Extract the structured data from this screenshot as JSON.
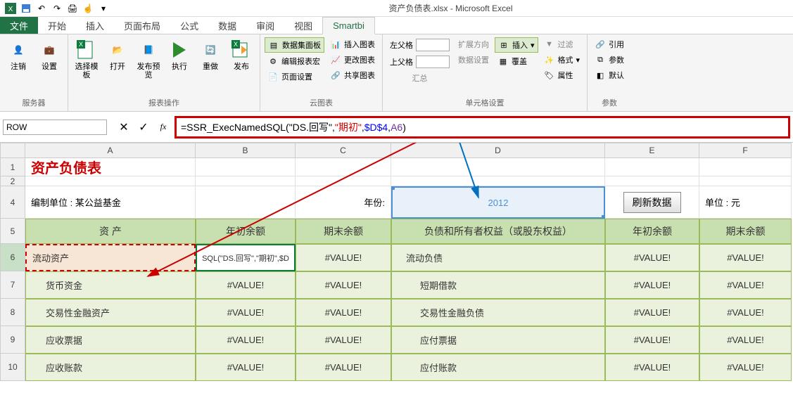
{
  "app": {
    "title": "资产负债表.xlsx - Microsoft Excel"
  },
  "tabs": {
    "file": "文件",
    "home": "开始",
    "insert": "插入",
    "layout": "页面布局",
    "formula": "公式",
    "data": "数据",
    "review": "审阅",
    "view": "视图",
    "smartbi": "Smartbi"
  },
  "ribbon": {
    "g_server": "服务器",
    "logout": "注销",
    "settings": "设置",
    "g_report": "报表操作",
    "choose_tpl": "选择模板",
    "open": "打开",
    "pub_preview": "发布预览",
    "exec": "执行",
    "redo": "重做",
    "publish": "发布",
    "g_chart": "云图表",
    "data_panel": "数据集面板",
    "edit_macro": "编辑报表宏",
    "page_setup": "页面设置",
    "insert_chart": "插入图表",
    "change_chart": "更改图表",
    "share_chart": "共享图表",
    "g_cell": "单元格设置",
    "left_parent": "左父格",
    "top_parent": "上父格",
    "summary": "汇总",
    "expand_dir": "扩展方向",
    "data_setting": "数据设置",
    "insert_btn": "插入",
    "overwrite": "覆盖",
    "filter": "过滤",
    "format": "格式",
    "attr": "属性",
    "g_param": "参数",
    "reference": "引用",
    "param_layout": "参数",
    "default": "默认"
  },
  "namebox": "ROW",
  "formula": {
    "pre": "=SSR_ExecNamedSQL(",
    "a1": "\"DS.回写\"",
    "a2": "\"期初\"",
    "a3": "$D$4",
    "a4": "A6",
    "post": ")"
  },
  "cols": [
    "A",
    "B",
    "C",
    "D",
    "E",
    "F"
  ],
  "sheet": {
    "title": "资产负债表",
    "org_label": "编制单位 : 某公益基金",
    "year_label": "年份:",
    "year_value": "2012",
    "refresh": "刷新数据",
    "unit": "单位 : 元",
    "headers": [
      "资 产",
      "年初余额",
      "期末余额",
      "负债和所有者权益（或股东权益）",
      "年初余额",
      "期末余额"
    ],
    "b6_raw": "SQL(\"DS.回写\",\"期初\",$D",
    "rows": [
      {
        "a": "流动资产",
        "d": "流动负债"
      },
      {
        "a": "货币资金",
        "d": "短期借款"
      },
      {
        "a": "交易性金融资产",
        "d": "交易性金融负债"
      },
      {
        "a": "应收票据",
        "d": "应付票据"
      },
      {
        "a": "应收账款",
        "d": "应付账款"
      }
    ],
    "valerr": "#VALUE!"
  }
}
